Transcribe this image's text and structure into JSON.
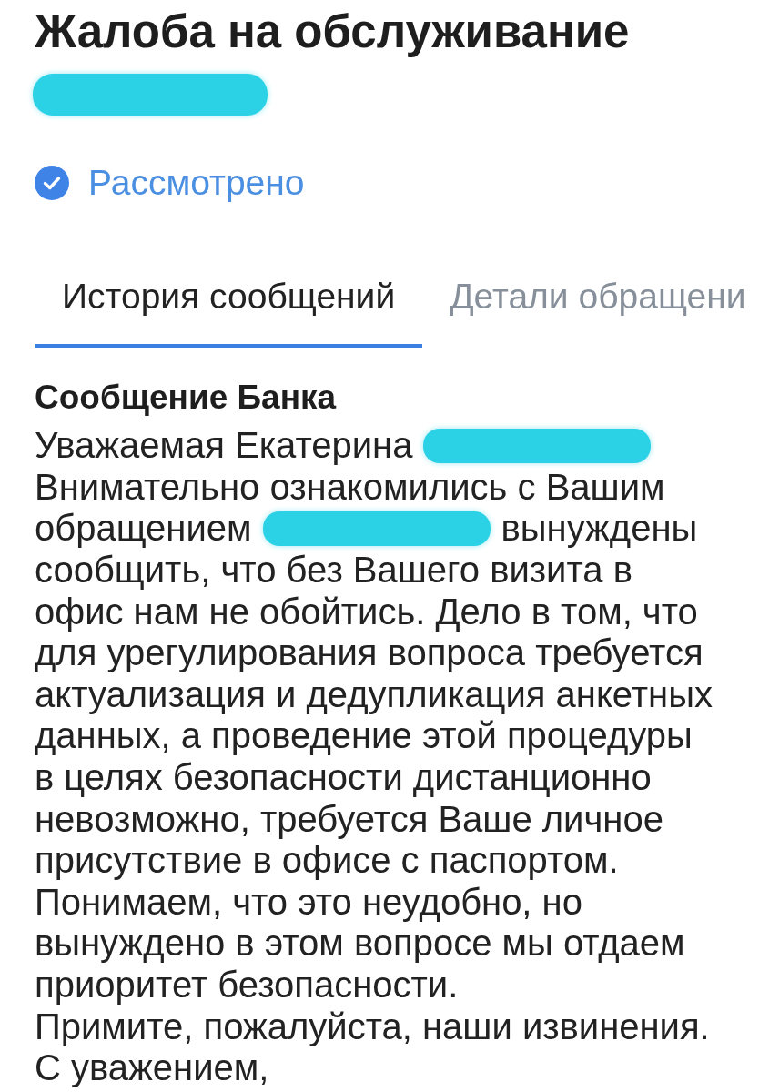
{
  "header": {
    "title": "Жалоба на обслуживание",
    "subtitle": {
      "kind": "redaction"
    }
  },
  "status": {
    "label": "Рассмотрено",
    "done": true
  },
  "tabs": [
    {
      "label": "История сообщений",
      "selected": true
    },
    {
      "label": "Детали обращени",
      "selected": false
    }
  ],
  "message": {
    "heading": "Сообщение Банка",
    "lines": [
      [
        {
          "kind": "text",
          "text": "Уважаемая Екатерина"
        },
        {
          "kind": "redaction"
        }
      ],
      [
        {
          "kind": "text",
          "text": "Внимательно ознакомились с Вашим"
        }
      ],
      [
        {
          "kind": "text",
          "text": "обращением"
        },
        {
          "kind": "redaction"
        },
        {
          "kind": "text",
          "text": "вынуждены"
        }
      ],
      [
        {
          "kind": "text",
          "text": "сообщить, что без Вашего визита в"
        }
      ],
      [
        {
          "kind": "text",
          "text": "офис нам не обойтись. Дело в том, что"
        }
      ],
      [
        {
          "kind": "text",
          "text": "для урегулирования вопроса требуется"
        }
      ],
      [
        {
          "kind": "text",
          "text": "актуализация и дедупликация анкетных"
        }
      ],
      [
        {
          "kind": "text",
          "text": "данных, а проведение этой процедуры"
        }
      ],
      [
        {
          "kind": "text",
          "text": "в целях безопасности дистанционно"
        }
      ],
      [
        {
          "kind": "text",
          "text": "невозможно, требуется Ваше личное"
        }
      ],
      [
        {
          "kind": "text",
          "text": "присутствие в офисе с паспортом."
        }
      ],
      [
        {
          "kind": "text",
          "text": "Понимаем, что это неудобно, но"
        }
      ],
      [
        {
          "kind": "text",
          "text": "вынуждено в этом вопросе мы отдаем"
        }
      ],
      [
        {
          "kind": "text",
          "text": "приоритет безопасности."
        }
      ],
      [
        {
          "kind": "text",
          "text": "Примите, пожалуйста, наши извинения."
        }
      ],
      [
        {
          "kind": "text",
          "text": "С уважением,"
        }
      ]
    ]
  }
}
